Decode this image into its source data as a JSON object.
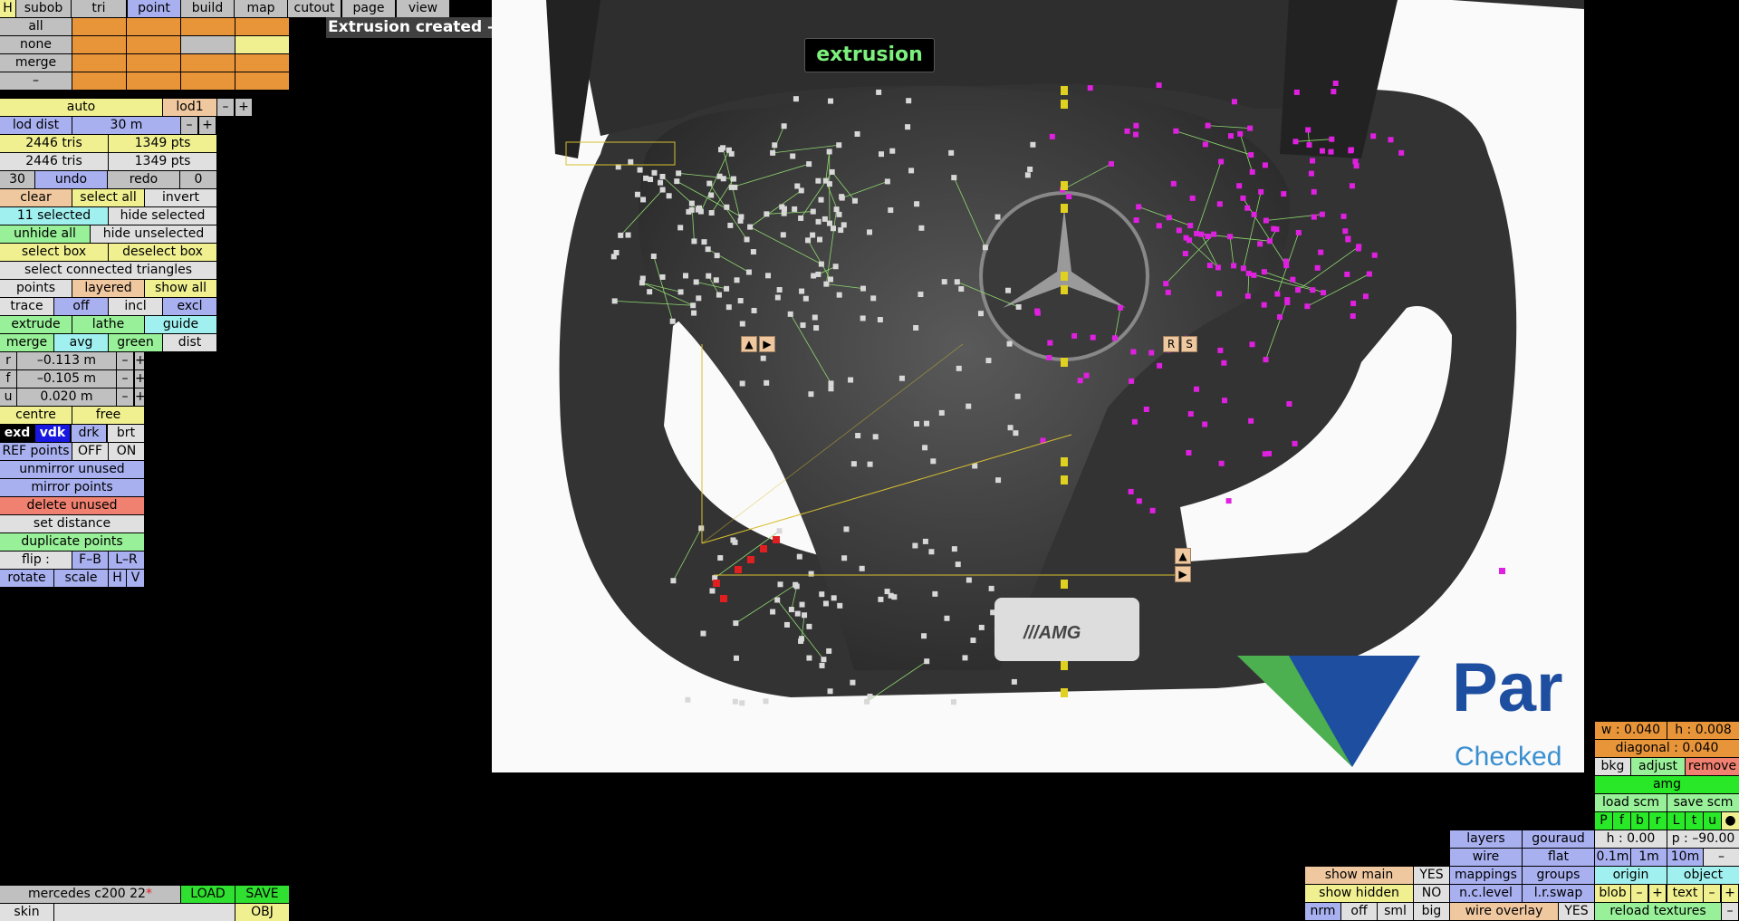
{
  "top_tabs": [
    "H",
    "subob",
    "tri",
    "point",
    "build",
    "map",
    "cutout",
    "page",
    "view"
  ],
  "row_labels": [
    "all",
    "none",
    "merge",
    "–"
  ],
  "message": "Extrusion created – selected points should now be moved",
  "mode_badge": "extrusion",
  "panel": {
    "auto": "auto",
    "lod1": "lod1",
    "minus": "–",
    "plus": "+",
    "lod_dist": "lod dist",
    "lod_val": "30 m",
    "tris1": "2446 tris",
    "pts1": "1349 pts",
    "tris2": "2446 tris",
    "pts2": "1349 pts",
    "undo_n": "30",
    "undo": "undo",
    "redo": "redo",
    "redo_n": "0",
    "clear": "clear",
    "select_all": "select all",
    "invert": "invert",
    "selected": "11 selected",
    "hide_selected": "hide selected",
    "unhide_all": "unhide all",
    "hide_unselected": "hide unselected",
    "select_box": "select box",
    "deselect_box": "deselect box",
    "select_connected": "select connected triangles",
    "points": "points",
    "layered": "layered",
    "show_all": "show all",
    "trace": "trace",
    "off": "off",
    "incl": "incl",
    "excl": "excl",
    "extrude": "extrude",
    "lathe": "lathe",
    "guide": "guide",
    "merge": "merge",
    "avg": "avg",
    "green": "green",
    "dist": "dist",
    "r": "r",
    "r_val": "–0.113 m",
    "f": "f",
    "f_val": "–0.105 m",
    "u": "u",
    "u_val": "0.020 m",
    "centre": "centre",
    "free": "free",
    "exd": "exd",
    "vdk": "vdk",
    "drk": "drk",
    "brt": "brt",
    "ref_points": "REF points",
    "ref_off": "OFF",
    "ref_on": "ON",
    "unmirror": "unmirror unused",
    "mirror": "mirror points",
    "delete_unused": "delete unused",
    "set_distance": "set distance",
    "duplicate": "duplicate points",
    "flip": "flip :",
    "fb": "F–B",
    "lr": "L–R",
    "rotate": "rotate",
    "scale": "scale",
    "h": "H",
    "v": "V"
  },
  "file": {
    "name": "mercedes c200 22",
    "star": "*",
    "load": "LOAD",
    "save": "SAVE",
    "skin": "skin",
    "obj": "OBJ"
  },
  "right": {
    "w": "w : 0.040",
    "h": "h : 0.008",
    "diagonal": "diagonal : 0.040",
    "bkg": "bkg",
    "adjust": "adjust",
    "remove": "remove",
    "amg": "amg",
    "load_scm": "load scm",
    "save_scm": "save scm",
    "views": [
      "P",
      "f",
      "b",
      "r",
      "L",
      "t",
      "u",
      "●"
    ],
    "h0": "h : 0.00",
    "p": "p : –90.00",
    "step1": "0.1m",
    "step2": "1m",
    "step3": "10m",
    "step_minus": "–",
    "origin": "origin",
    "object": "object",
    "blob": "blob",
    "text": "text",
    "minus": "–",
    "plus": "+",
    "reload": "reload textures"
  },
  "bottom_mid": {
    "layers": "layers",
    "gouraud": "gouraud",
    "wire": "wire",
    "flat": "flat",
    "mappings": "mappings",
    "groups": "groups",
    "nclevel": "n.c.level",
    "lrswap": "l.r.swap",
    "show_main": "show main",
    "yes": "YES",
    "show_hidden": "show hidden",
    "no": "NO",
    "nrm": "nrm",
    "off": "off",
    "sml": "sml",
    "big": "big",
    "wire_overlay": "wire overlay",
    "wo_yes": "YES"
  },
  "viewport": {
    "logo_text": "Par",
    "logo_sub": "Checked",
    "wheel_badge": "///AMG",
    "marker_rs": [
      "R",
      "S"
    ]
  },
  "colors": {
    "wire": "#8fd870",
    "selected": "#e020e0",
    "axis": "#e0d020"
  }
}
